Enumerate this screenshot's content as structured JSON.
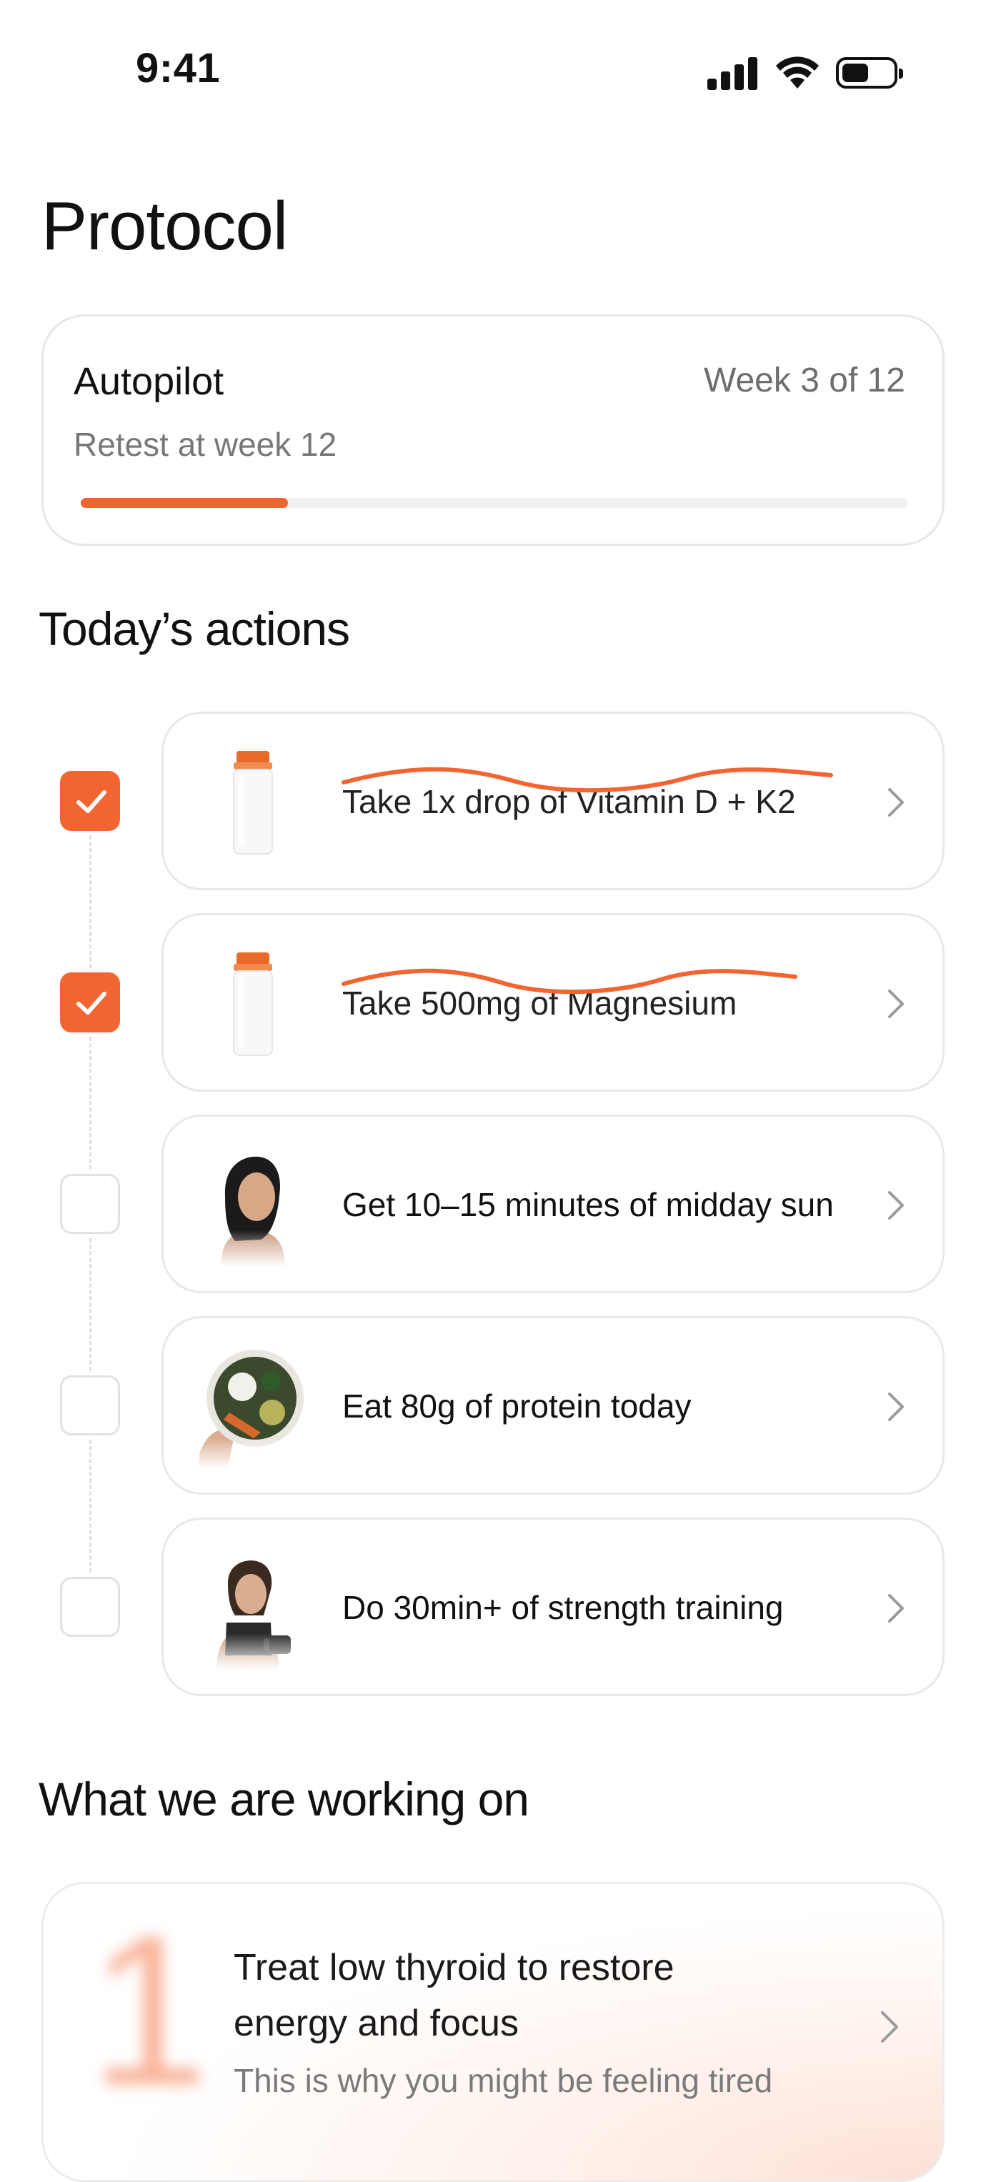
{
  "status_bar": {
    "time": "9:41"
  },
  "page": {
    "title": "Protocol"
  },
  "autopilot": {
    "title": "Autopilot",
    "week": "Week 3 of 12",
    "subtitle": "Retest at week 12",
    "progress": 0.25,
    "accent": "#f26430"
  },
  "actions_section": {
    "title": "Today’s actions"
  },
  "actions": [
    {
      "label": "Take 1x drop of Vitamin D + K2",
      "checked": true,
      "image": "supplement-bottle-image"
    },
    {
      "label": "Take 500mg of Magnesium",
      "checked": true,
      "image": "supplement-bottle-image"
    },
    {
      "label": "Get 10–15 minutes of midday sun",
      "checked": false,
      "image": "woman-portrait-image"
    },
    {
      "label": "Eat 80g of protein today",
      "checked": false,
      "image": "protein-bowl-image"
    },
    {
      "label": "Do 30min+ of strength training",
      "checked": false,
      "image": "woman-dumbbell-image"
    }
  ],
  "working_section": {
    "title": "What we are working on"
  },
  "working_on": {
    "number": "1",
    "title": "Treat low thyroid to restore energy and focus",
    "subtitle": "This is why you might be feeling tired"
  }
}
